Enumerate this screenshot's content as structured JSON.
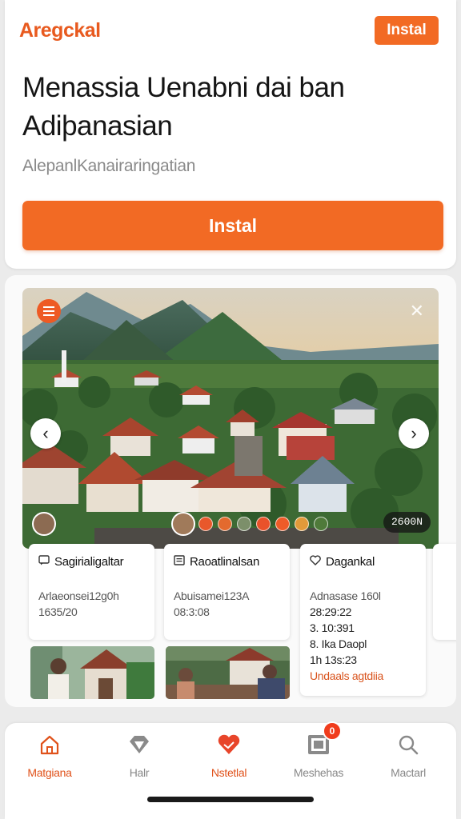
{
  "header": {
    "brand": "Aregckal",
    "install_small": "Instal"
  },
  "hero": {
    "title": "Menassia Uenabni dai ban Adiþanasian",
    "subtitle": "AlepanlKanairaringatian",
    "install_big": "Instal"
  },
  "gallery": {
    "counter": "2600N",
    "cards": [
      {
        "title": "Sagirialigaltar",
        "icon": "chat-icon",
        "lines": [
          "Arlaeonsei12g0h",
          "1635/20"
        ]
      },
      {
        "title": "Raoatlinalsan",
        "icon": "document-icon",
        "lines": [
          "Abuisamei123A",
          "08:3:08"
        ]
      },
      {
        "title": "Dagankal",
        "icon": "heart-icon",
        "lines": [
          "Adnasase 160l",
          "28:29:22",
          "3. 10:391",
          "8. Ika Daopl",
          "1h 13s:23"
        ],
        "accent_line": "Undaals agtdiia"
      }
    ]
  },
  "bottom_nav": {
    "items": [
      {
        "label": "Matgiana",
        "icon": "home-icon",
        "active": true
      },
      {
        "label": "Halr",
        "icon": "diamond-icon",
        "active": false
      },
      {
        "label": "Nstetlal",
        "icon": "heart-icon",
        "active": true
      },
      {
        "label": "Meshehas",
        "icon": "inbox-icon",
        "active": false,
        "badge": "0"
      },
      {
        "label": "Mactarl",
        "icon": "search-icon",
        "active": false
      }
    ]
  },
  "colors": {
    "accent": "#f26a24",
    "brand": "#e85a1f",
    "badge": "#f03c1c"
  }
}
